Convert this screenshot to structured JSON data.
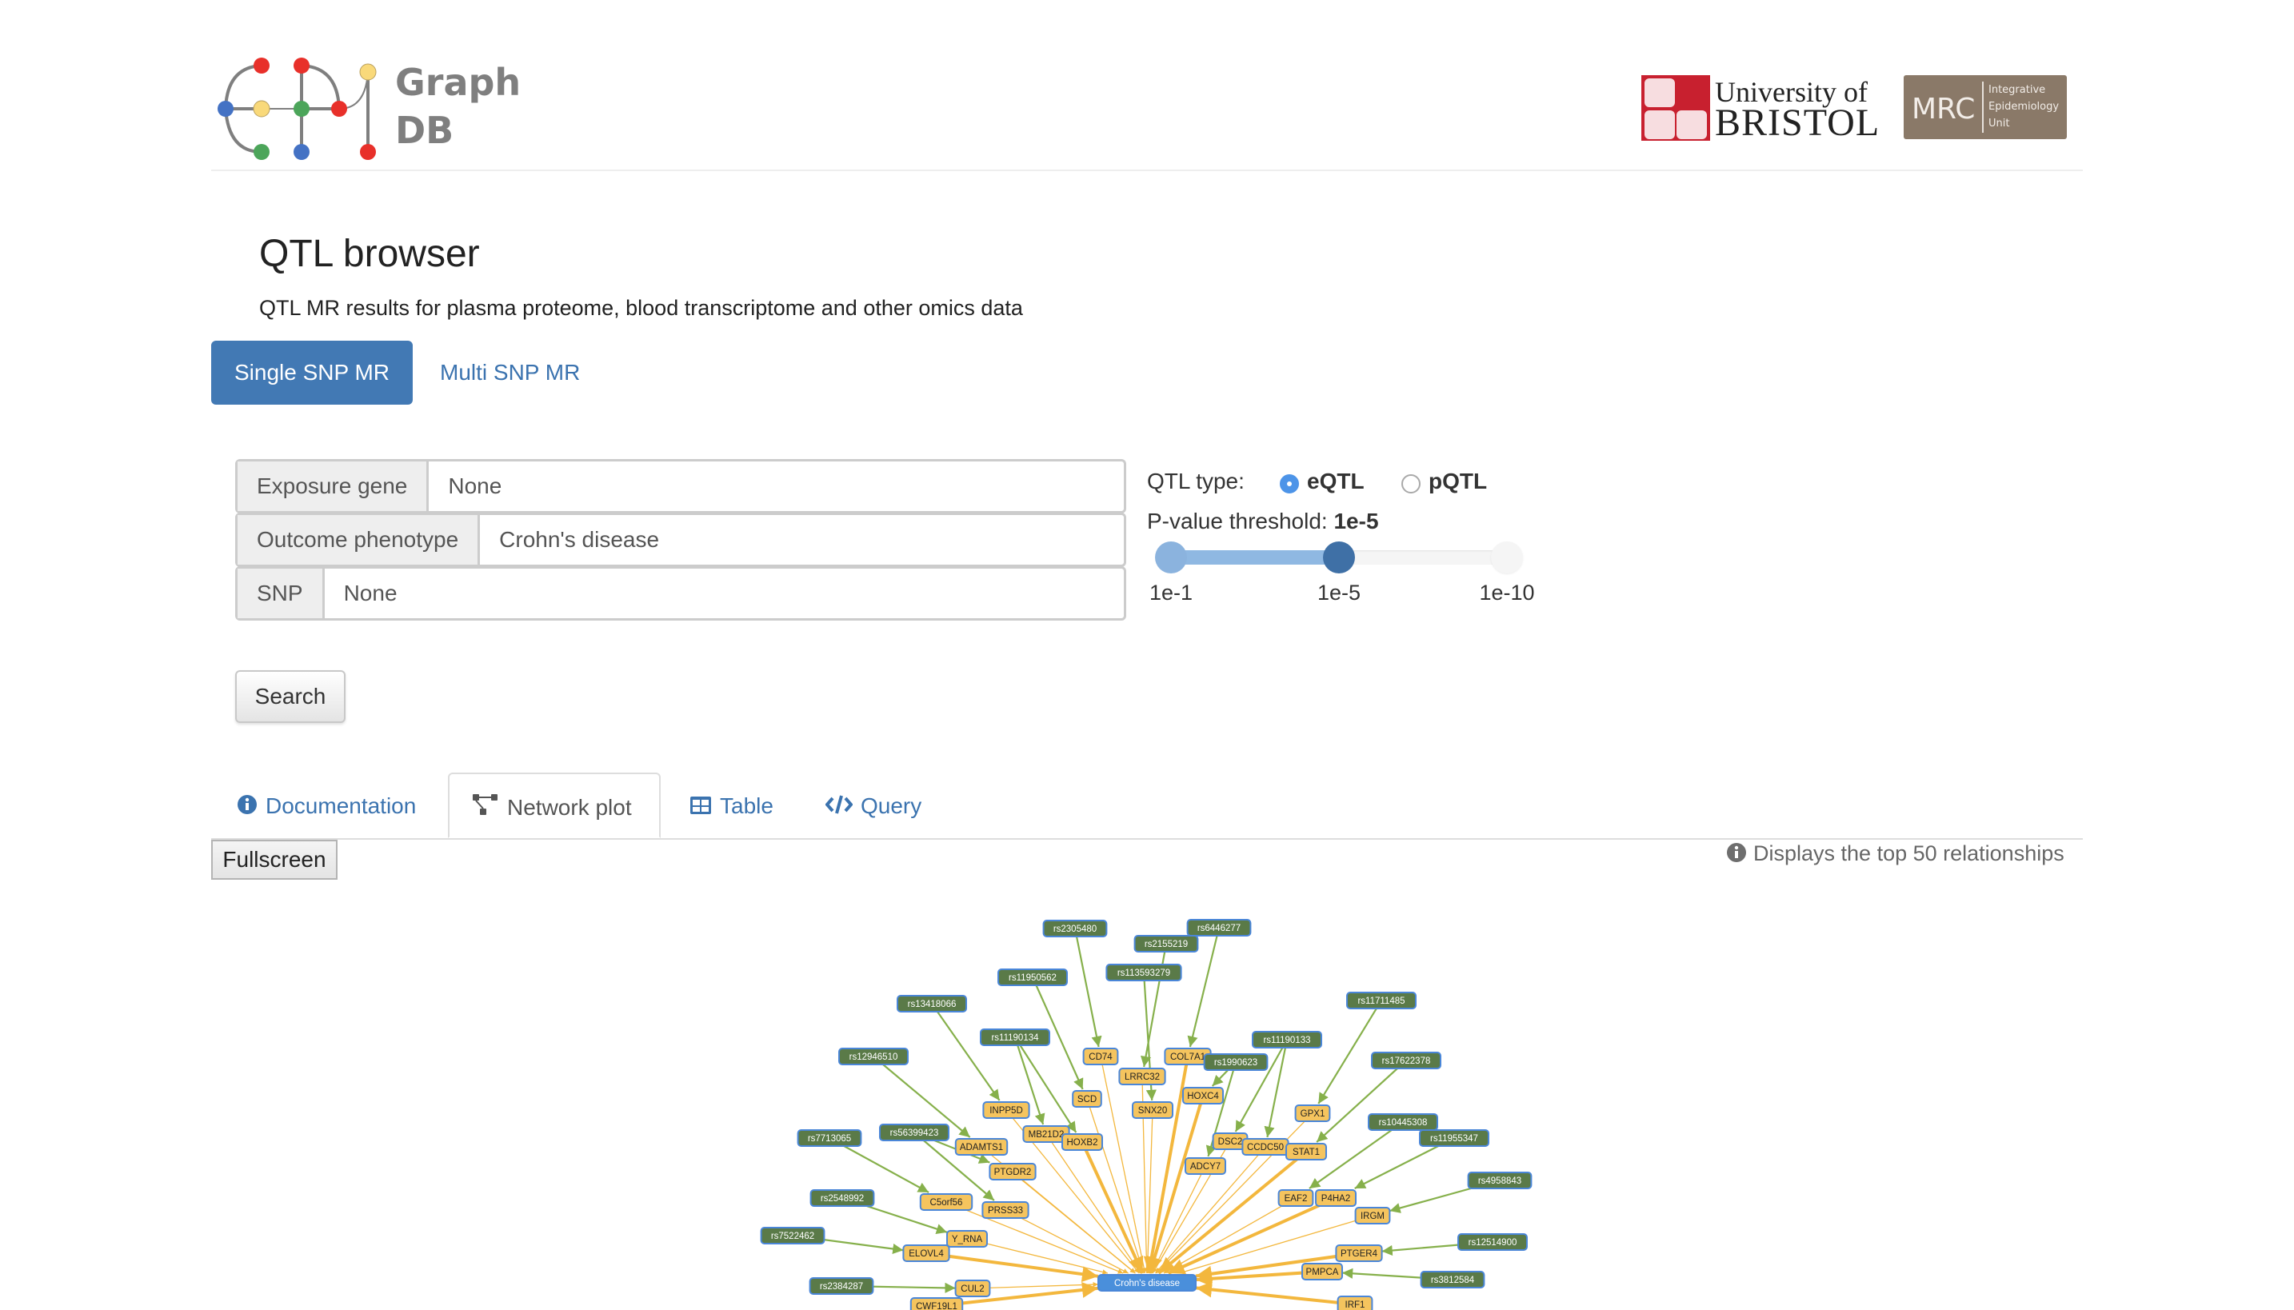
{
  "header": {
    "logo_text_line1": "Graph",
    "logo_text_line2": "DB",
    "partner1_line1": "University of",
    "partner1_line2": "BRISTOL",
    "partner2_big": "MRC",
    "partner2_small": [
      "Integrative",
      "Epidemiology",
      "Unit"
    ]
  },
  "page": {
    "title": "QTL browser",
    "subtitle": "QTL MR results for plasma proteome, blood transcriptome and other omics data"
  },
  "mode_pills": [
    {
      "label": "Single SNP MR",
      "active": true
    },
    {
      "label": "Multi SNP MR",
      "active": false
    }
  ],
  "form": {
    "exposure_gene": {
      "label": "Exposure gene",
      "value": "None"
    },
    "outcome_phenotype": {
      "label": "Outcome phenotype",
      "value": "Crohn's disease"
    },
    "snp": {
      "label": "SNP",
      "value": "None"
    },
    "qtl_type": {
      "label": "QTL type:",
      "options": [
        "eQTL",
        "pQTL"
      ],
      "selected": "eQTL"
    },
    "pvalue": {
      "label": "P-value threshold:",
      "value": "1e-5",
      "ticks": [
        "1e-1",
        "1e-5",
        "1e-10"
      ],
      "selected_index": 1
    },
    "search_label": "Search"
  },
  "tabs": [
    {
      "label": "Documentation",
      "icon": "info-circle-icon",
      "active": false
    },
    {
      "label": "Network plot",
      "icon": "network-icon",
      "active": true
    },
    {
      "label": "Table",
      "icon": "table-icon",
      "active": false
    },
    {
      "label": "Query",
      "icon": "code-icon",
      "active": false
    }
  ],
  "network_panel": {
    "fullscreen_label": "Fullscreen",
    "note": "Displays the top 50 relationships",
    "colors": {
      "snp_fill": "#5a7a48",
      "gene_fill": "#f5c45e",
      "outcome_fill": "#4a8fdb",
      "node_border": "#4a86d8",
      "snp_gene_edge": "#86b04b",
      "gene_outcome_edge": "#f3b73d"
    },
    "outcome": "Crohn's disease",
    "snp_nodes": [
      "rs2305480",
      "rs6446277",
      "rs2155219",
      "rs113593279",
      "rs11950562",
      "rs13418066",
      "rs11190134",
      "rs12946510",
      "rs11711485",
      "rs11190133",
      "rs1990623",
      "rs17622378",
      "rs10445308",
      "rs11955347",
      "rs4958843",
      "rs12514900",
      "rs3812584",
      "rs7713065",
      "rs56399423",
      "rs2548992",
      "rs7522462",
      "rs2384287"
    ],
    "gene_nodes": [
      "CD74",
      "COL7A1",
      "LRRC32",
      "SCD",
      "HOXC4",
      "SNX20",
      "INPP5D",
      "MB21D2",
      "HOXB2",
      "ADAMTS1",
      "PTGDR2",
      "DSC2",
      "CCDC50",
      "STAT1",
      "ADCY7",
      "GPX1",
      "EAF2",
      "P4HA2",
      "IRGM",
      "C5orf56",
      "PRSS33",
      "Y_RNA",
      "ELOVL4",
      "PTGER4",
      "PMPCA",
      "CUL2",
      "CWF19L1",
      "IRF1"
    ],
    "snp_gene_edges": [
      [
        "rs2305480",
        "CD74"
      ],
      [
        "rs6446277",
        "COL7A1"
      ],
      [
        "rs2155219",
        "LRRC32"
      ],
      [
        "rs113593279",
        "SNX20"
      ],
      [
        "rs11950562",
        "SCD"
      ],
      [
        "rs13418066",
        "INPP5D"
      ],
      [
        "rs11190134",
        "MB21D2"
      ],
      [
        "rs11190134",
        "HOXB2"
      ],
      [
        "rs12946510",
        "ADAMTS1"
      ],
      [
        "rs11711485",
        "GPX1"
      ],
      [
        "rs11190133",
        "DSC2"
      ],
      [
        "rs11190133",
        "CCDC50"
      ],
      [
        "rs1990623",
        "HOXC4"
      ],
      [
        "rs1990623",
        "ADCY7"
      ],
      [
        "rs17622378",
        "STAT1"
      ],
      [
        "rs10445308",
        "EAF2"
      ],
      [
        "rs11955347",
        "P4HA2"
      ],
      [
        "rs4958843",
        "IRGM"
      ],
      [
        "rs12514900",
        "PTGER4"
      ],
      [
        "rs3812584",
        "PMPCA"
      ],
      [
        "rs7713065",
        "C5orf56"
      ],
      [
        "rs56399423",
        "PTGDR2"
      ],
      [
        "rs56399423",
        "PRSS33"
      ],
      [
        "rs2548992",
        "Y_RNA"
      ],
      [
        "rs7522462",
        "ELOVL4"
      ],
      [
        "rs2384287",
        "CUL2"
      ]
    ],
    "gene_outcome_edges": [
      {
        "gene": "CD74",
        "strength": "weak"
      },
      {
        "gene": "COL7A1",
        "strength": "strong"
      },
      {
        "gene": "LRRC32",
        "strength": "weak"
      },
      {
        "gene": "SCD",
        "strength": "weak"
      },
      {
        "gene": "HOXC4",
        "strength": "strong"
      },
      {
        "gene": "SNX20",
        "strength": "weak"
      },
      {
        "gene": "INPP5D",
        "strength": "weak"
      },
      {
        "gene": "MB21D2",
        "strength": "weak"
      },
      {
        "gene": "HOXB2",
        "strength": "strong"
      },
      {
        "gene": "ADAMTS1",
        "strength": "weak"
      },
      {
        "gene": "PTGDR2",
        "strength": "weak"
      },
      {
        "gene": "DSC2",
        "strength": "weak"
      },
      {
        "gene": "CCDC50",
        "strength": "weak"
      },
      {
        "gene": "STAT1",
        "strength": "strong"
      },
      {
        "gene": "ADCY7",
        "strength": "weak"
      },
      {
        "gene": "GPX1",
        "strength": "weak"
      },
      {
        "gene": "EAF2",
        "strength": "weak"
      },
      {
        "gene": "P4HA2",
        "strength": "strong"
      },
      {
        "gene": "IRGM",
        "strength": "weak"
      },
      {
        "gene": "C5orf56",
        "strength": "weak"
      },
      {
        "gene": "PRSS33",
        "strength": "weak"
      },
      {
        "gene": "Y_RNA",
        "strength": "weak"
      },
      {
        "gene": "ELOVL4",
        "strength": "strong"
      },
      {
        "gene": "PTGER4",
        "strength": "strong"
      },
      {
        "gene": "PMPCA",
        "strength": "strong"
      },
      {
        "gene": "CUL2",
        "strength": "weak"
      },
      {
        "gene": "CWF19L1",
        "strength": "strong"
      },
      {
        "gene": "IRF1",
        "strength": "strong"
      }
    ]
  }
}
